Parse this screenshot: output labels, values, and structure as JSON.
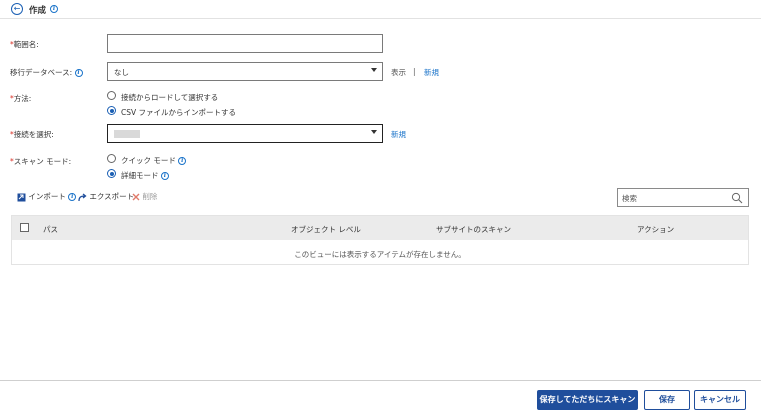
{
  "header": {
    "title": "作成"
  },
  "form": {
    "range_name": {
      "label": "範囲名:",
      "value": ""
    },
    "migration_db": {
      "label": "移行データベース:",
      "value": "なし",
      "show_link": "表示",
      "separator": "|",
      "new_link": "新規"
    },
    "method": {
      "label": "方法:",
      "options": [
        {
          "label": "接続からロードして選択する",
          "selected": false
        },
        {
          "label": "CSV ファイルからインポートする",
          "selected": true
        }
      ]
    },
    "connection": {
      "label": "接続を選択:",
      "new_link": "新規"
    },
    "scan_mode": {
      "label": "スキャン モード:",
      "options": [
        {
          "label": "クイック モード",
          "selected": false
        },
        {
          "label": "詳細モード",
          "selected": true
        }
      ]
    }
  },
  "toolbar": {
    "import": "インポート",
    "export": "エクスポート",
    "delete": "削除"
  },
  "search": {
    "placeholder": "検索"
  },
  "table": {
    "columns": [
      "パス",
      "オブジェクト レベル",
      "サブサイトのスキャン",
      "アクション"
    ],
    "empty_message": "このビューには表示するアイテムが存在しません。"
  },
  "footer": {
    "save_scan": "保存してただちにスキャン",
    "save": "保存",
    "cancel": "キャンセル"
  },
  "colors": {
    "accent": "#1f4e9c",
    "link": "#1a73c9",
    "required": "#d93025"
  }
}
